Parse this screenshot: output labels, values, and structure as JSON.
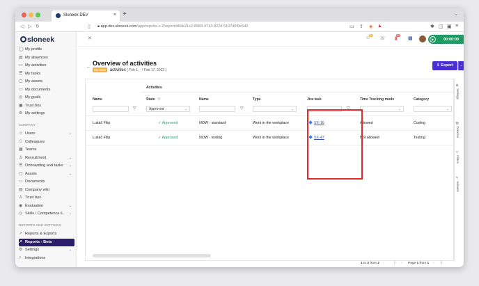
{
  "browser": {
    "tab_title": "Sloneek DEV",
    "url_host": "app-dev.sloneek.com",
    "url_path": "/app/reports-v-2/report/d6de21e2-8983-4713-822d-5107d0f0e5d2",
    "close_icon": "×",
    "new_tab_icon": "+"
  },
  "brand": {
    "name": "sloneek"
  },
  "sidebar": {
    "personal": [
      {
        "label": "My profile",
        "icon": "user-icon"
      },
      {
        "label": "My absences",
        "icon": "calendar-icon"
      },
      {
        "label": "My activities",
        "icon": "book-icon"
      },
      {
        "label": "My tasks",
        "icon": "tasks-icon"
      },
      {
        "label": "My assets",
        "icon": "box-icon"
      },
      {
        "label": "My documents",
        "icon": "folder-icon"
      },
      {
        "label": "My goals",
        "icon": "goal-icon"
      },
      {
        "label": "Trust box",
        "icon": "lock-icon"
      },
      {
        "label": "My settings",
        "icon": "gear-icon"
      }
    ],
    "company_title": "COMPANY",
    "company": [
      {
        "label": "Users",
        "icon": "users-icon",
        "expandable": true
      },
      {
        "label": "Colleagues",
        "icon": "colleagues-icon"
      },
      {
        "label": "Teams",
        "icon": "teams-icon"
      },
      {
        "label": "Recruitment",
        "icon": "recruitment-icon",
        "expandable": true
      },
      {
        "label": "Onboarding and tasks",
        "icon": "onboarding-icon",
        "expandable": true
      },
      {
        "label": "Assets",
        "icon": "box-icon",
        "expandable": true
      },
      {
        "label": "Documents",
        "icon": "folder-icon"
      },
      {
        "label": "Company wiki",
        "icon": "wiki-icon"
      },
      {
        "label": "Trust box",
        "icon": "lock-icon"
      },
      {
        "label": "Evaluation",
        "icon": "evaluation-icon",
        "expandable": true
      },
      {
        "label": "Skills / Competence il..",
        "icon": "skills-icon",
        "expandable": true
      }
    ],
    "reports_title": "REPORTS AND SETTINGS",
    "reports": [
      {
        "label": "Reports & Exports",
        "icon": "chart-icon"
      },
      {
        "label": "Reports - Beta",
        "icon": "chart-icon",
        "active": true
      },
      {
        "label": "Settings",
        "icon": "gear-icon",
        "expandable": true
      },
      {
        "label": "Integrations",
        "icon": "integrations-icon"
      }
    ]
  },
  "header": {
    "timer_value": "00:00:00",
    "badge_1": "20",
    "badge_2": "99"
  },
  "page": {
    "back_icon": "←",
    "title": "Overview of activities",
    "range_tag": "My team",
    "range_label": "activities",
    "range_dates": "( Feb 1, - / Feb 17, 2023 )",
    "export_label": "Export"
  },
  "table": {
    "group_label": "Activities",
    "columns": [
      "Name",
      "State",
      "Name",
      "Type",
      "Jira task",
      "Time Tracking mode",
      "Category"
    ],
    "filters": {
      "state": "Approved"
    },
    "rows": [
      {
        "user": "Lukáč Filip",
        "state": "Approved",
        "activity": "NOW - standard",
        "type": "Work in the workplace",
        "jira": "SX-16",
        "mode": "Allowed",
        "category": "Coding"
      },
      {
        "user": "Lukáč Filip",
        "state": "Approved",
        "activity": "NOW - testing",
        "type": "Work in the workplace",
        "jira": "SX-47",
        "mode": "Not allowed",
        "category": "Testing"
      }
    ]
  },
  "side_panel": [
    "Settings",
    "Columns",
    "Filters",
    "Subsets"
  ],
  "footer": {
    "count_from": "1",
    "count_to": "2",
    "count_total": "2",
    "page_current": "1",
    "page_total": "1"
  }
}
